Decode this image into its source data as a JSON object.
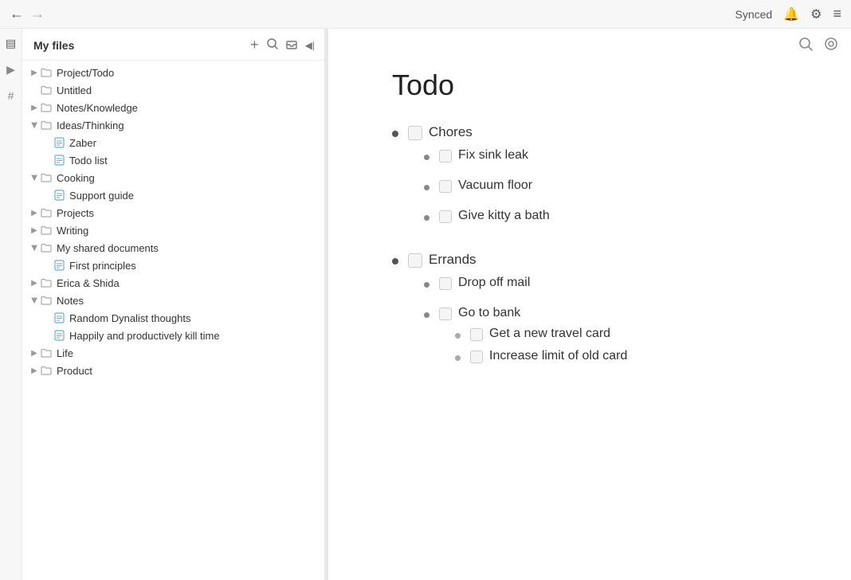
{
  "topbar": {
    "back_label": "←",
    "forward_label": "→",
    "synced_label": "Synced",
    "bell_icon": "🔔",
    "settings_icon": "⚙",
    "menu_icon": "≡"
  },
  "sidebar": {
    "title": "My files",
    "add_btn": "+",
    "search_btn": "🔍",
    "inbox_btn": "📥",
    "collapse_btn": "◀|",
    "tree": [
      {
        "id": "project-todo",
        "label": "Project/Todo",
        "type": "folder",
        "indent": 0,
        "expanded": false
      },
      {
        "id": "untitled",
        "label": "Untitled",
        "type": "folder",
        "indent": 0,
        "expanded": false,
        "noArrow": true
      },
      {
        "id": "notes-knowledge",
        "label": "Notes/Knowledge",
        "type": "folder",
        "indent": 0,
        "expanded": false
      },
      {
        "id": "ideas-thinking",
        "label": "Ideas/Thinking",
        "type": "folder",
        "indent": 0,
        "expanded": true
      },
      {
        "id": "zaber",
        "label": "Zaber",
        "type": "file",
        "indent": 1
      },
      {
        "id": "todo-list",
        "label": "Todo list",
        "type": "file",
        "indent": 1
      },
      {
        "id": "cooking",
        "label": "Cooking",
        "type": "folder",
        "indent": 0,
        "expanded": true
      },
      {
        "id": "support-guide",
        "label": "Support guide",
        "type": "file",
        "indent": 1
      },
      {
        "id": "projects",
        "label": "Projects",
        "type": "folder",
        "indent": 0,
        "expanded": false
      },
      {
        "id": "writing",
        "label": "Writing",
        "type": "folder",
        "indent": 0,
        "expanded": false
      },
      {
        "id": "my-shared-documents",
        "label": "My shared documents",
        "type": "folder",
        "indent": 0,
        "expanded": true
      },
      {
        "id": "first-principles",
        "label": "First principles",
        "type": "file",
        "indent": 1
      },
      {
        "id": "erica-shida",
        "label": "Erica & Shida",
        "type": "folder",
        "indent": 0,
        "expanded": false
      },
      {
        "id": "notes",
        "label": "Notes",
        "type": "folder",
        "indent": 0,
        "expanded": true
      },
      {
        "id": "random-dynalist",
        "label": "Random Dynalist thoughts",
        "type": "file",
        "indent": 1
      },
      {
        "id": "happily",
        "label": "Happily and productively kill time",
        "type": "file",
        "indent": 1
      },
      {
        "id": "life",
        "label": "Life",
        "type": "folder",
        "indent": 0,
        "expanded": false
      },
      {
        "id": "product",
        "label": "Product",
        "type": "folder",
        "indent": 0,
        "expanded": false
      }
    ]
  },
  "content": {
    "doc_title": "Todo",
    "items": [
      {
        "id": "chores",
        "label": "Chores",
        "level": 0,
        "children": [
          {
            "id": "fix-sink",
            "label": "Fix sink leak",
            "level": 1
          },
          {
            "id": "vacuum",
            "label": "Vacuum floor",
            "level": 1
          },
          {
            "id": "bath",
            "label": "Give kitty a bath",
            "level": 1
          }
        ]
      },
      {
        "id": "errands",
        "label": "Errands",
        "level": 0,
        "children": [
          {
            "id": "drop-mail",
            "label": "Drop off mail",
            "level": 1
          },
          {
            "id": "bank",
            "label": "Go to bank",
            "level": 1,
            "children": [
              {
                "id": "travel-card",
                "label": "Get a new travel card",
                "level": 2
              },
              {
                "id": "increase-limit",
                "label": "Increase limit of old card",
                "level": 2
              }
            ]
          }
        ]
      }
    ]
  },
  "icons": {
    "search": "🔍",
    "eye": "👁",
    "back": "←",
    "forward": "→"
  }
}
